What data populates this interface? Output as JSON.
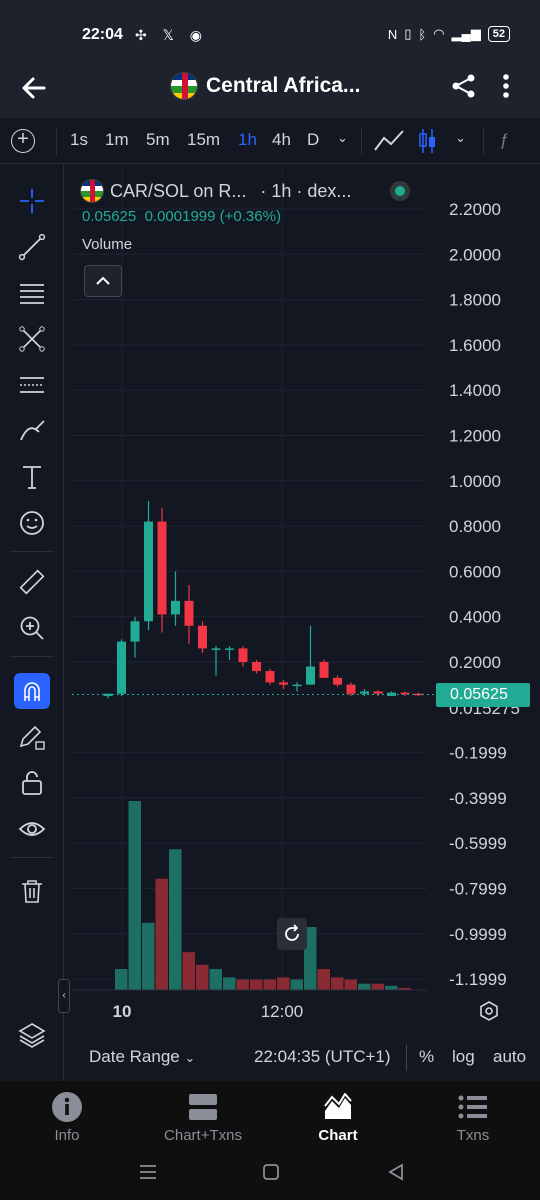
{
  "status_bar": {
    "time": "22:04",
    "battery": "52"
  },
  "header": {
    "title": "Central Africa..."
  },
  "toolbar": {
    "intervals": [
      "1s",
      "1m",
      "5m",
      "15m",
      "1h",
      "4h",
      "D"
    ],
    "active_interval": "1h"
  },
  "chart": {
    "symbol": "CAR/SOL on R...",
    "interval_label": "· 1h · dex...",
    "last_value": "0.05625",
    "change": "0.0001999 (+0.36%)",
    "volume_label": "Volume",
    "price_label": "0.05625",
    "hidden_axis_label": "0.015275",
    "up_color": "#22ab94",
    "down_color": "#f23645"
  },
  "chart_data": {
    "type": "candlestick",
    "title": "CAR/SOL on R... · 1h · dex...",
    "y_axis_ticks": [
      "2.2000",
      "2.0000",
      "1.8000",
      "1.6000",
      "1.4000",
      "1.2000",
      "1.0000",
      "0.8000",
      "0.6000",
      "0.4000",
      "0.2000",
      "-0.1999",
      "-0.3999",
      "-0.5999",
      "-0.7999",
      "-0.9999",
      "-1.1999"
    ],
    "ylim": [
      -1.25,
      2.28
    ],
    "x_axis_ticks": [
      "10",
      "12:00"
    ],
    "candles": [
      {
        "o": 0.05,
        "h": 0.06,
        "l": 0.04,
        "c": 0.06
      },
      {
        "o": 0.06,
        "h": 0.3,
        "l": 0.05,
        "c": 0.29
      },
      {
        "o": 0.29,
        "h": 0.4,
        "l": 0.22,
        "c": 0.38
      },
      {
        "o": 0.38,
        "h": 0.91,
        "l": 0.34,
        "c": 0.82
      },
      {
        "o": 0.82,
        "h": 0.88,
        "l": 0.33,
        "c": 0.41
      },
      {
        "o": 0.41,
        "h": 0.6,
        "l": 0.36,
        "c": 0.47
      },
      {
        "o": 0.47,
        "h": 0.54,
        "l": 0.28,
        "c": 0.36
      },
      {
        "o": 0.36,
        "h": 0.38,
        "l": 0.24,
        "c": 0.26
      },
      {
        "o": 0.26,
        "h": 0.27,
        "l": 0.14,
        "c": 0.26
      },
      {
        "o": 0.26,
        "h": 0.27,
        "l": 0.21,
        "c": 0.26
      },
      {
        "o": 0.26,
        "h": 0.27,
        "l": 0.18,
        "c": 0.2
      },
      {
        "o": 0.2,
        "h": 0.21,
        "l": 0.15,
        "c": 0.16
      },
      {
        "o": 0.16,
        "h": 0.17,
        "l": 0.1,
        "c": 0.11
      },
      {
        "o": 0.11,
        "h": 0.12,
        "l": 0.08,
        "c": 0.1
      },
      {
        "o": 0.1,
        "h": 0.11,
        "l": 0.07,
        "c": 0.1
      },
      {
        "o": 0.1,
        "h": 0.36,
        "l": 0.1,
        "c": 0.18
      },
      {
        "o": 0.2,
        "h": 0.21,
        "l": 0.13,
        "c": 0.13
      },
      {
        "o": 0.13,
        "h": 0.14,
        "l": 0.09,
        "c": 0.1
      },
      {
        "o": 0.1,
        "h": 0.11,
        "l": 0.05,
        "c": 0.06
      },
      {
        "o": 0.06,
        "h": 0.08,
        "l": 0.05,
        "c": 0.07
      },
      {
        "o": 0.07,
        "h": 0.075,
        "l": 0.05,
        "c": 0.06
      },
      {
        "o": 0.05,
        "h": 0.07,
        "l": 0.05,
        "c": 0.065
      },
      {
        "o": 0.065,
        "h": 0.07,
        "l": 0.05,
        "c": 0.06
      },
      {
        "o": 0.06,
        "h": 0.065,
        "l": 0.05,
        "c": 0.056
      }
    ],
    "volumes": [
      0.1,
      0.9,
      0.32,
      0.53,
      0.67,
      0.18,
      0.12,
      0.1,
      0.06,
      0.05,
      0.05,
      0.05,
      0.06,
      0.05,
      0.3,
      0.1,
      0.06,
      0.05,
      0.03,
      0.03,
      0.02,
      0.01
    ],
    "grid": true
  },
  "bottom_bar": {
    "date_range": "Date Range",
    "clock": "22:04:35 (UTC+1)",
    "percent": "%",
    "log": "log",
    "auto": "auto"
  },
  "nav": {
    "items": [
      "Info",
      "Chart+Txns",
      "Chart",
      "Txns"
    ],
    "active": "Chart"
  }
}
